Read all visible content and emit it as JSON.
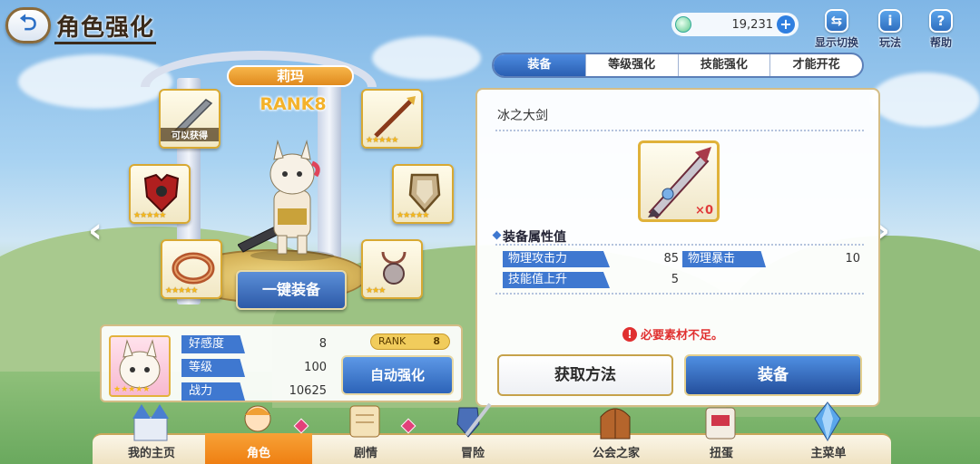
{
  "header": {
    "title": "角色强化",
    "back_symbol": "⮌"
  },
  "currency": {
    "value": "19,231",
    "icon": "gem-icon"
  },
  "top_actions": [
    {
      "label": "显示切换",
      "icon": "display-switch-icon"
    },
    {
      "label": "玩法",
      "icon": "info-icon",
      "symbol": "i"
    },
    {
      "label": "帮助",
      "icon": "help-icon",
      "symbol": "?"
    }
  ],
  "character": {
    "name": "莉玛",
    "rank": "RANK8"
  },
  "equip_slots": [
    {
      "slot": "top-left",
      "item": "ice-greatsword",
      "stars": "",
      "obtain_label": "可以获得"
    },
    {
      "slot": "top-right",
      "item": "spear",
      "stars": "★★★★★"
    },
    {
      "slot": "mid-left",
      "item": "armor",
      "stars": "★★★★★"
    },
    {
      "slot": "mid-right",
      "item": "shield",
      "stars": "★★★★★"
    },
    {
      "slot": "bottom-left",
      "item": "bracelet",
      "stars": "★★★★★"
    },
    {
      "slot": "bottom-right",
      "item": "amulet",
      "stars": "★★★"
    }
  ],
  "onekey_equip_label": "一键装备",
  "char_info": {
    "affection_label": "好感度",
    "affection_value": "8",
    "level_label": "等级",
    "level_value": "100",
    "power_label": "战力",
    "power_value": "10625",
    "rank_pill_label": "RANK",
    "rank_pill_value": "8",
    "portrait_stars": "★★★★★",
    "auto_enhance_label": "自动强化"
  },
  "tabs": [
    {
      "label": "装备",
      "active": true
    },
    {
      "label": "等级强化",
      "active": false
    },
    {
      "label": "技能强化",
      "active": false
    },
    {
      "label": "才能开花",
      "active": false
    }
  ],
  "item_detail": {
    "name": "冰之大剑",
    "count": "×0",
    "section_title": "装备属性值",
    "stats": [
      {
        "label": "物理攻击力",
        "value": "85"
      },
      {
        "label": "物理暴击",
        "value": "10"
      },
      {
        "label": "技能值上升",
        "value": "5"
      }
    ],
    "warning": "必要素材不足。",
    "howto_label": "获取方法",
    "equip_label": "装备"
  },
  "bottom_nav": [
    {
      "label": "我的主页",
      "icon": "castle-icon",
      "active": false
    },
    {
      "label": "角色",
      "icon": "character-icon",
      "active": true
    },
    {
      "label": "剧情",
      "icon": "scroll-icon",
      "active": false,
      "badge": true
    },
    {
      "label": "冒险",
      "icon": "sword-shield-icon",
      "active": false
    },
    {
      "label": "公会之家",
      "icon": "guild-door-icon",
      "active": false
    },
    {
      "label": "扭蛋",
      "icon": "gacha-icon",
      "active": false
    },
    {
      "label": "主菜单",
      "icon": "crystal-icon",
      "active": false
    }
  ],
  "colors": {
    "accent_blue": "#3f78d0",
    "gold": "#d8a932",
    "active_orange": "#f08a1c",
    "warning_red": "#e03030"
  }
}
